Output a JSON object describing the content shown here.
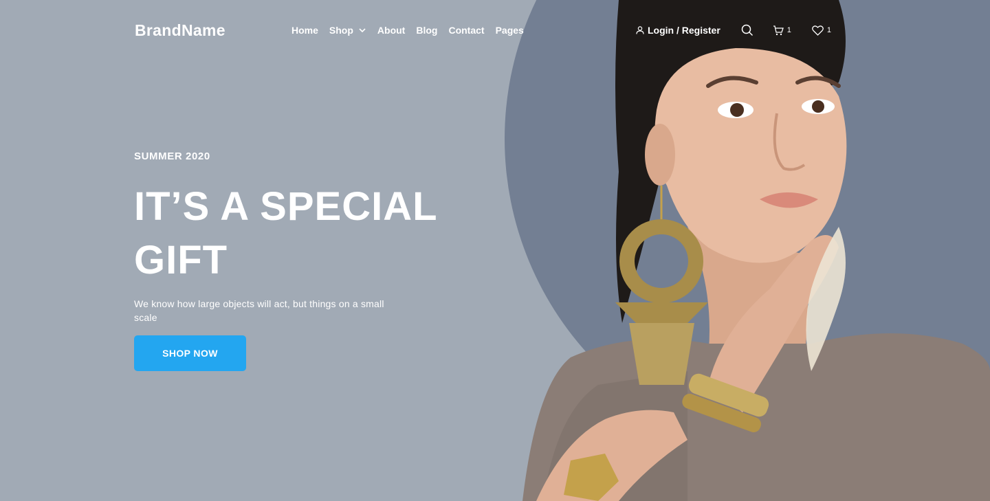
{
  "brand": "BrandName",
  "nav": {
    "items": [
      {
        "label": "Home"
      },
      {
        "label": "Shop"
      },
      {
        "label": "About"
      },
      {
        "label": "Blog"
      },
      {
        "label": "Contact"
      },
      {
        "label": "Pages"
      }
    ],
    "login_label": "Login / Register",
    "cart_count": "1",
    "wishlist_count": "1"
  },
  "hero": {
    "eyebrow": "SUMMER 2020",
    "headline_line1": "IT’S A SPECIAL",
    "headline_line2": "GIFT",
    "description": "We know how large objects will act, but things on a small scale",
    "cta_label": "SHOP NOW"
  },
  "colors": {
    "background": "#a1aab5",
    "circle": "#737f93",
    "accent": "#23a6f0",
    "text": "#ffffff"
  },
  "icons": [
    "user-icon",
    "search-icon",
    "cart-icon",
    "heart-icon",
    "chevron-down-icon"
  ]
}
